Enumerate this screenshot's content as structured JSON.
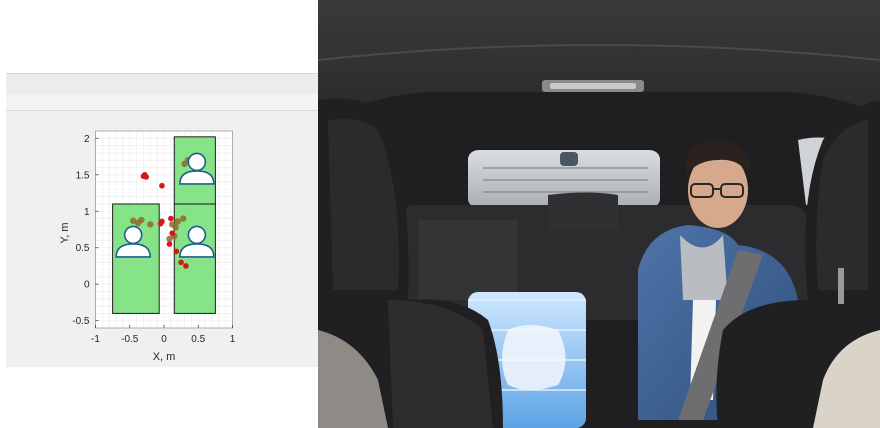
{
  "chart_data": {
    "type": "scatter",
    "title": "",
    "xlabel": "X, m",
    "ylabel": "Y, m",
    "xlim": [
      -1,
      1
    ],
    "ylim": [
      -0.6,
      2.1
    ],
    "xticks": [
      "-1",
      "-0.5",
      "0",
      "0.5",
      "1"
    ],
    "yticks": [
      "-0.5",
      "0",
      "0.5",
      "1",
      "1.5",
      "2"
    ],
    "grid": true,
    "seat_zones": [
      {
        "x0": -0.75,
        "x1": -0.07,
        "y0": -0.4,
        "y1": 1.1,
        "occupied": true
      },
      {
        "x0": 0.15,
        "x1": 0.75,
        "y0": -0.4,
        "y1": 1.1,
        "occupied": true
      },
      {
        "x0": 0.15,
        "x1": 0.75,
        "y0": 1.1,
        "y1": 2.02,
        "occupied": true
      }
    ],
    "occupant_icons": [
      {
        "x": -0.45,
        "y": 0.58
      },
      {
        "x": 0.48,
        "y": 0.58
      },
      {
        "x": 0.48,
        "y": 1.58
      }
    ],
    "points_red": [
      [
        -0.3,
        1.48
      ],
      [
        -0.28,
        1.5
      ],
      [
        -0.26,
        1.47
      ],
      [
        -0.03,
        1.35
      ],
      [
        -0.05,
        0.83
      ],
      [
        -0.03,
        0.86
      ],
      [
        0.1,
        0.9
      ],
      [
        0.12,
        0.7
      ],
      [
        0.08,
        0.55
      ],
      [
        0.18,
        0.45
      ],
      [
        0.25,
        0.3
      ],
      [
        0.32,
        0.25
      ]
    ],
    "points_olive": [
      [
        -0.45,
        0.87
      ],
      [
        -0.38,
        0.84
      ],
      [
        -0.33,
        0.88
      ],
      [
        -0.2,
        0.82
      ],
      [
        0.12,
        0.82
      ],
      [
        0.17,
        0.78
      ],
      [
        0.2,
        0.86
      ],
      [
        0.28,
        0.9
      ],
      [
        0.08,
        0.62
      ],
      [
        0.15,
        0.66
      ],
      [
        0.3,
        1.65
      ],
      [
        0.35,
        1.7
      ]
    ]
  }
}
